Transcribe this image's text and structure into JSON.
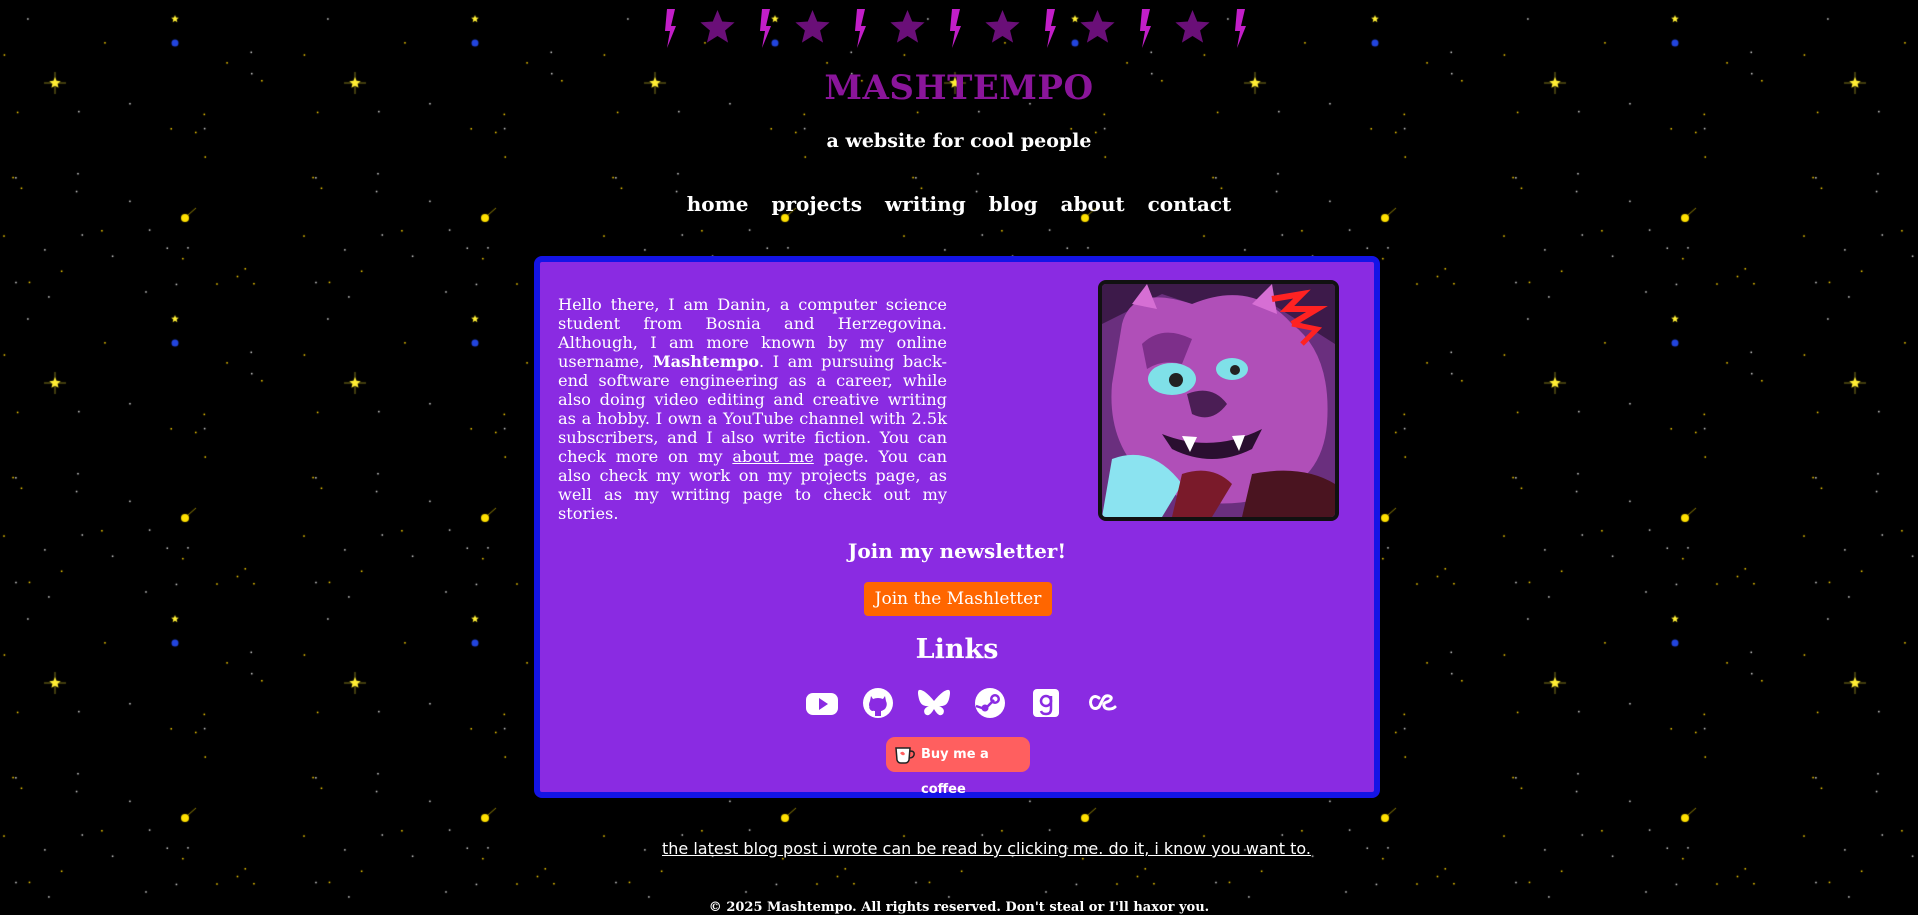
{
  "header": {
    "site_title": "MASHTEMPO",
    "tagline": "a website for cool people"
  },
  "nav": {
    "items": [
      "home",
      "projects",
      "writing",
      "blog",
      "about",
      "contact"
    ]
  },
  "intro": {
    "text_before": "Hello there, I am Danin, a computer science student from Bosnia and Herzegovina. Although, I am more known by my online username, ",
    "username": "Mashtempo",
    "text_middle": ". I am pursuing back-end software engineering as a career, while also doing video editing and creative writing as a hobby. I own a YouTube channel with 2.5k subscribers, and I also write fiction. You can check more on my ",
    "about_link": "about me",
    "text_after": " page. You can also check my work on my projects page, as well as my writing page to check out my stories."
  },
  "newsletter": {
    "heading": "Join my newsletter!",
    "button_label": "Join the Mashletter"
  },
  "links": {
    "heading": "Links",
    "icons": [
      "youtube-icon",
      "github-icon",
      "bluesky-icon",
      "steam-icon",
      "goodreads-icon",
      "lastfm-icon"
    ]
  },
  "coffee": {
    "label": "Buy me a coffee"
  },
  "footer": {
    "latest_post": "the latest blog post i wrote can be read by clicking me. do it, i know you want to.",
    "copyright": "© 2025 Mashtempo. All rights reserved. Don't steal or I'll haxor you."
  },
  "colors": {
    "background": "#000000",
    "title": "#8a159a",
    "panel": "#8a2be2",
    "panel_border": "#1414e6",
    "newsletter_button": "#ff6600",
    "coffee_button": "#ff5f5f"
  }
}
